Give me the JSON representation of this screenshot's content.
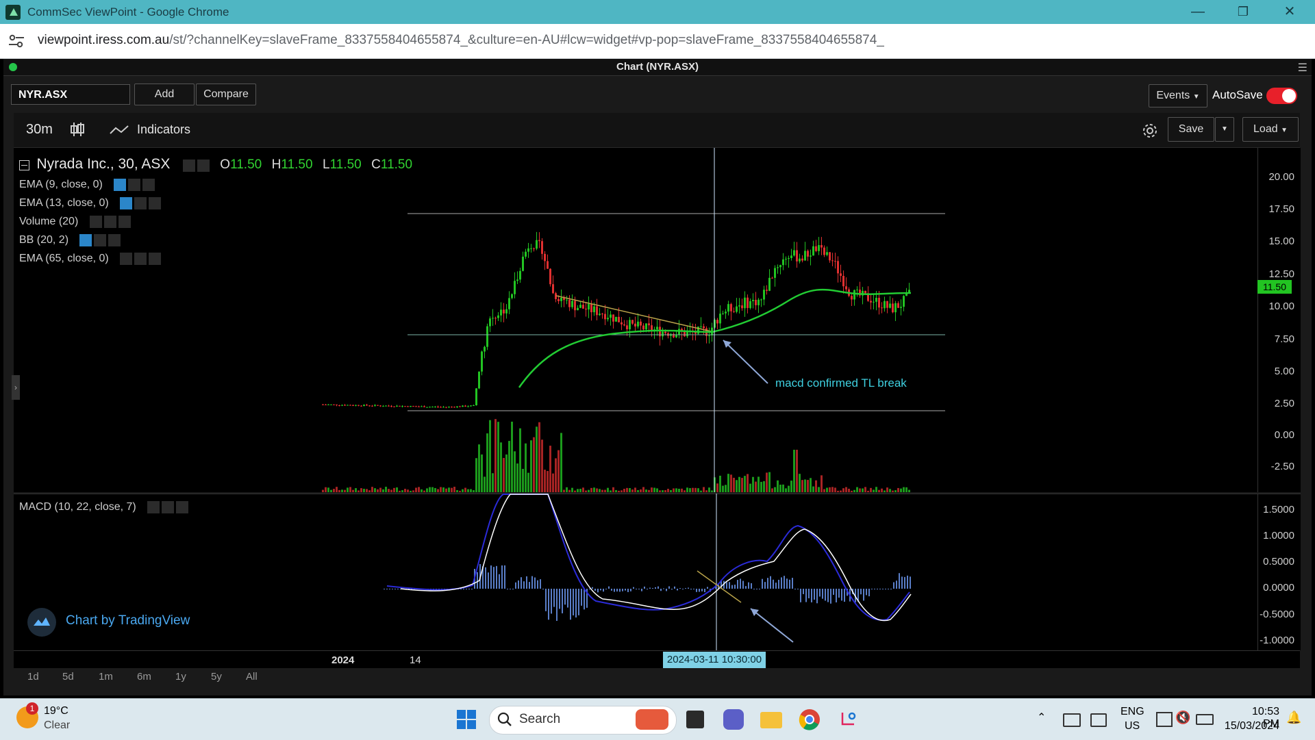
{
  "browser": {
    "window_title": "CommSec ViewPoint - Google Chrome",
    "url_host": "viewpoint.iress.com.au",
    "url_path": "/st/?channelKey=slaveFrame_8337558404655874_&culture=en-AU#lcw=widget#vp-pop=slaveFrame_8337558404655874_"
  },
  "app": {
    "header_title": "Chart (NYR.ASX)",
    "symbol": "NYR.ASX",
    "add_label": "Add",
    "compare_label": "Compare",
    "events_label": "Events",
    "autosave_label": "AutoSave",
    "autosave_on": true
  },
  "chart_toolbar": {
    "interval": "30m",
    "indicators_label": "Indicators",
    "save_label": "Save",
    "load_label": "Load"
  },
  "legend": {
    "title": "Nyrada Inc., 30, ASX",
    "o_label": "O",
    "o_val": "11.50",
    "h_label": "H",
    "h_val": "11.50",
    "l_label": "L",
    "l_val": "11.50",
    "c_label": "C",
    "c_val": "11.50",
    "studies": [
      "EMA (9, close, 0)",
      "EMA (13, close, 0)",
      "Volume (20)",
      "BB (20, 2)",
      "EMA (65, close, 0)"
    ],
    "macd": "MACD (10, 22, close, 7)"
  },
  "price_axis": [
    "20.00",
    "17.50",
    "15.00",
    "12.50",
    "10.00",
    "7.50",
    "5.00",
    "2.50",
    "0.00",
    "-2.50"
  ],
  "price_tag": "11.50",
  "macd_axis": [
    "1.5000",
    "1.0000",
    "0.5000",
    "0.0000",
    "-0.5000",
    "-1.0000"
  ],
  "time_axis": {
    "year": "2024",
    "day": "14",
    "crosshair": "2024-03-11 10:30:00"
  },
  "annotation": "macd confirmed TL break",
  "watermark": "Chart by TradingView",
  "ranges": [
    "1d",
    "5d",
    "1m",
    "6m",
    "1y",
    "5y",
    "All"
  ],
  "taskbar": {
    "temp": "19°C",
    "weather": "Clear",
    "weather_badge": "1",
    "search_placeholder": "Search",
    "lang": "ENG",
    "region": "US",
    "time": "10:53 PM",
    "date": "15/03/2024"
  },
  "colors": {
    "up": "#22c422",
    "down": "#e03030",
    "ema": "#22cc33",
    "macd_line": "#2b2bd8",
    "signal_line": "#ffffff",
    "hist": "#5a7ec8",
    "annotation": "#3fd0e0",
    "trendline": "#b8a24a"
  },
  "chart_data": {
    "type": "candlestick",
    "title": "Nyrada Inc., 30, ASX",
    "ylim": [
      -2.5,
      20
    ],
    "macd_ylim": [
      -1,
      1.5
    ]
  }
}
